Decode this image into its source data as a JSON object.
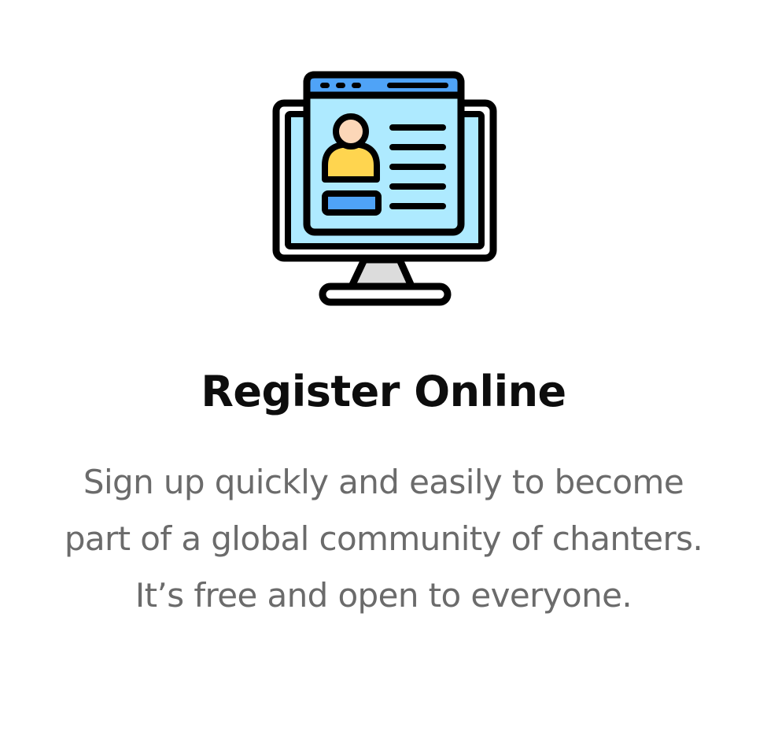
{
  "feature": {
    "icon": "monitor-user-profile-icon",
    "title": "Register Online",
    "description": "Sign up quickly and easily to become part of a global community of chanters. It’s free and open to everyone."
  },
  "colors": {
    "title": "#0d0d0d",
    "description": "#6b6b6b",
    "outline": "#000000",
    "window_bar": "#4fa3f7",
    "screen_fill": "#aeeaff",
    "avatar_head": "#fcd7b8",
    "avatar_body": "#ffd54f",
    "stand": "#dcdcdc"
  }
}
